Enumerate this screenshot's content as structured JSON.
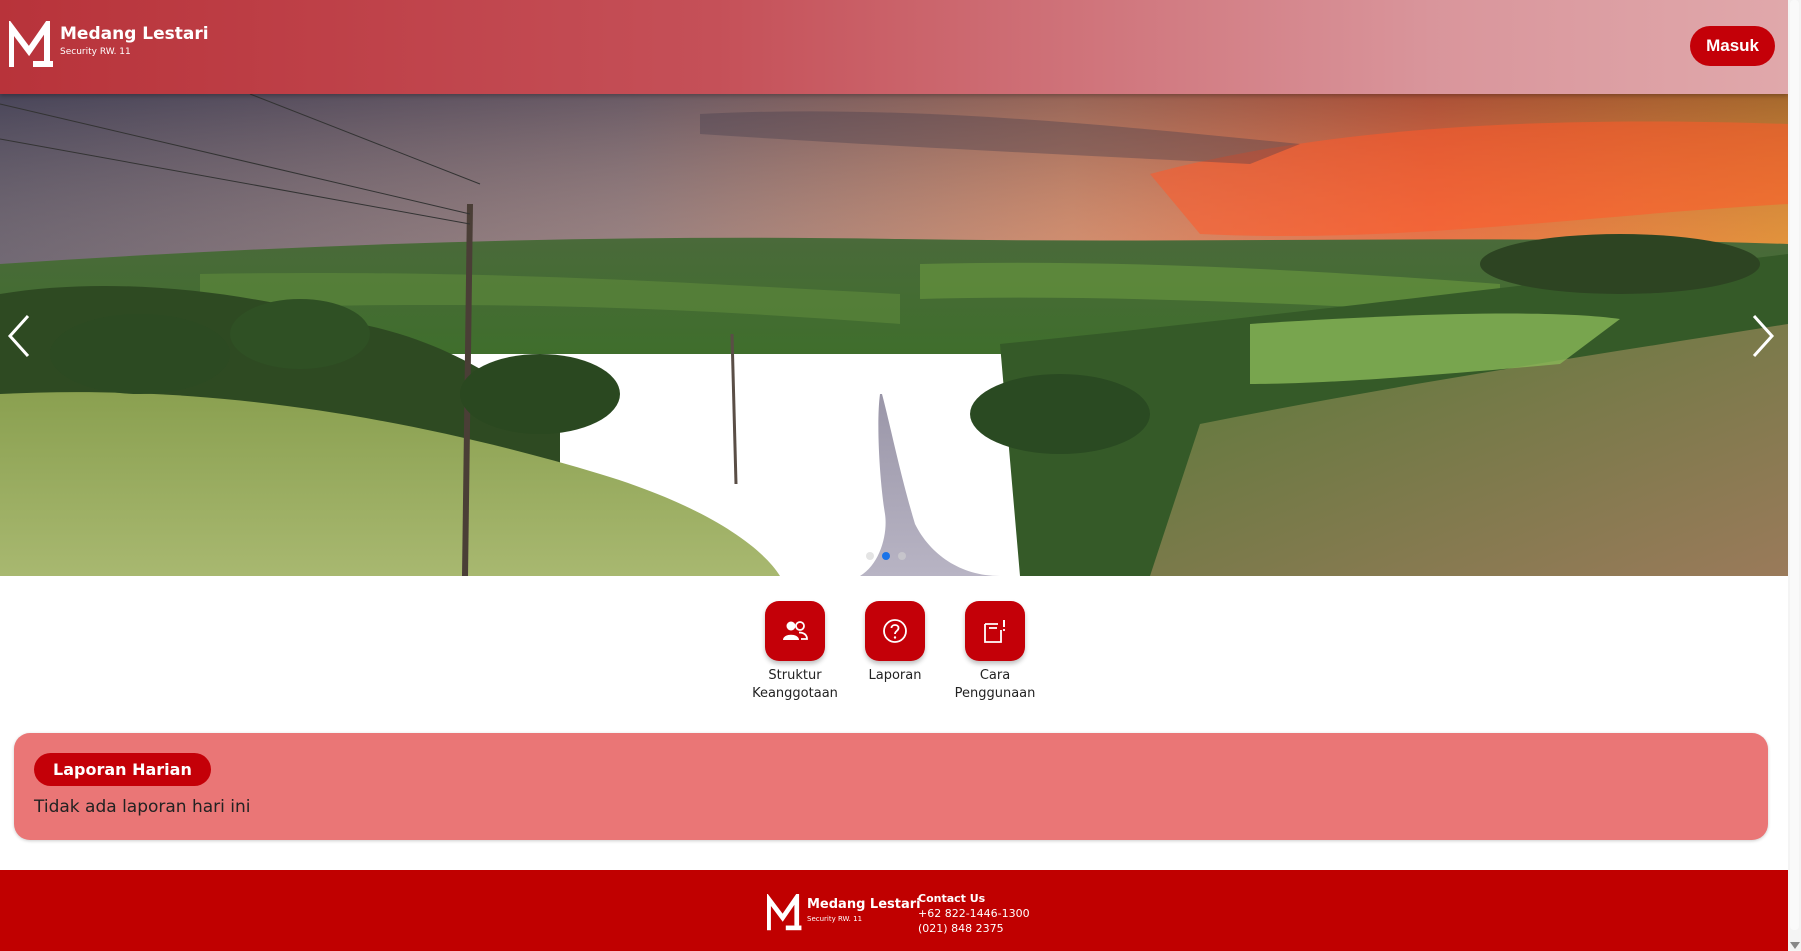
{
  "header": {
    "brand_name": "Medang Lestari",
    "brand_sub": "Security RW. 11",
    "login_label": "Masuk"
  },
  "carousel": {
    "slide_count": 3,
    "active_index": 1,
    "prev_icon": "chevron-left-icon",
    "next_icon": "chevron-right-icon"
  },
  "menu": {
    "items": [
      {
        "label_line1": "Struktur",
        "label_line2": "Keanggotaan",
        "icon": "users-icon"
      },
      {
        "label_line1": "Laporan",
        "label_line2": "",
        "icon": "question-circle-icon"
      },
      {
        "label_line1": "Cara",
        "label_line2": "Penggunaan",
        "icon": "note-alert-icon"
      }
    ]
  },
  "report": {
    "title": "Laporan Harian",
    "empty_text": "Tidak ada laporan hari ini"
  },
  "footer": {
    "brand_name": "Medang Lestari",
    "brand_sub": "Security RW. 11",
    "contact_title": "Contact Us",
    "phone1": "+62 822-1446-1300",
    "phone2": "(021) 848 2375"
  },
  "colors": {
    "primary_red": "#c40008",
    "report_bg": "#ea7676",
    "footer_bg": "#c00000",
    "active_dot": "#1a73e8"
  }
}
